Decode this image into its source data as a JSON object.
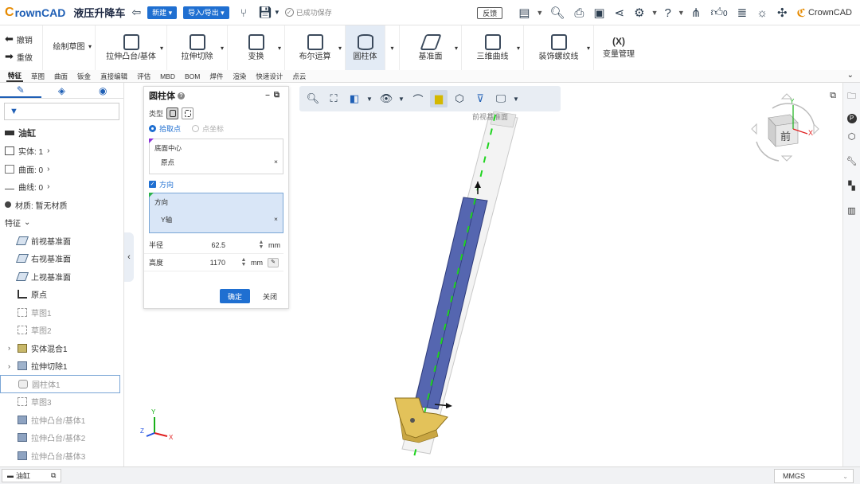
{
  "header": {
    "brand": "rownCAD",
    "brand_c": "C",
    "doc_title": "液压升降车",
    "new_btn": "新建 ▾",
    "import_btn": "导入/导出 ▾",
    "saved_text": "已成功保存",
    "feedback": "反馈",
    "like_count": "0",
    "brand_right": "CrownCAD"
  },
  "ribbon": {
    "undo": "撤销",
    "redo": "重做",
    "sketch": "绘制草图",
    "boss": "拉伸凸台/基体",
    "cut": "拉伸切除",
    "transform": "变换",
    "boolean": "布尔运算",
    "cylinder": "圆柱体",
    "plane": "基准面",
    "curve3d": "三维曲线",
    "thread": "装饰螺纹线",
    "var_icon": "(X)",
    "var_mgr": "变量管理"
  },
  "tabs": [
    "特征",
    "草图",
    "曲面",
    "钣金",
    "直接编辑",
    "评估",
    "MBD",
    "BOM",
    "焊件",
    "渲染",
    "快速设计",
    "点云"
  ],
  "tree": {
    "part": "油缸",
    "solid": "实体: 1",
    "surface": "曲面: 0",
    "curve": "曲线: 0",
    "material": "材质: 暂无材质",
    "features_header": "特征",
    "items": [
      {
        "label": "前视基准面",
        "type": "plane"
      },
      {
        "label": "右视基准面",
        "type": "plane"
      },
      {
        "label": "上视基准面",
        "type": "plane"
      },
      {
        "label": "原点",
        "type": "origin"
      },
      {
        "label": "草图1",
        "type": "sketch"
      },
      {
        "label": "草图2",
        "type": "sketch"
      },
      {
        "label": "实体混合1",
        "type": "solid"
      },
      {
        "label": "拉伸切除1",
        "type": "solid"
      },
      {
        "label": "圆柱体1",
        "type": "cyl"
      },
      {
        "label": "草图3",
        "type": "sketch"
      },
      {
        "label": "拉伸凸台/基体1",
        "type": "boss"
      },
      {
        "label": "拉伸凸台/基体2",
        "type": "boss"
      },
      {
        "label": "拉伸凸台/基体3",
        "type": "boss"
      }
    ]
  },
  "dialog": {
    "title": "圆柱体",
    "type_label": "类型",
    "pick_point": "拾取点",
    "coord_point": "点坐标",
    "base_center_label": "底面中心",
    "base_center_value": "原点",
    "direction_check": "方向",
    "direction_label": "方向",
    "direction_value": "Y轴",
    "radius_label": "半径",
    "radius_value": "62.5",
    "height_label": "高度",
    "height_value": "1170",
    "unit": "mm",
    "ok": "确定",
    "close": "关闭"
  },
  "viewport": {
    "front_label": "前视基准面",
    "cube_face": "前",
    "axis_x": "X",
    "axis_y": "Y",
    "axis_z": "Z"
  },
  "status": {
    "doc_tab": "油缸",
    "units": "MMGS"
  }
}
